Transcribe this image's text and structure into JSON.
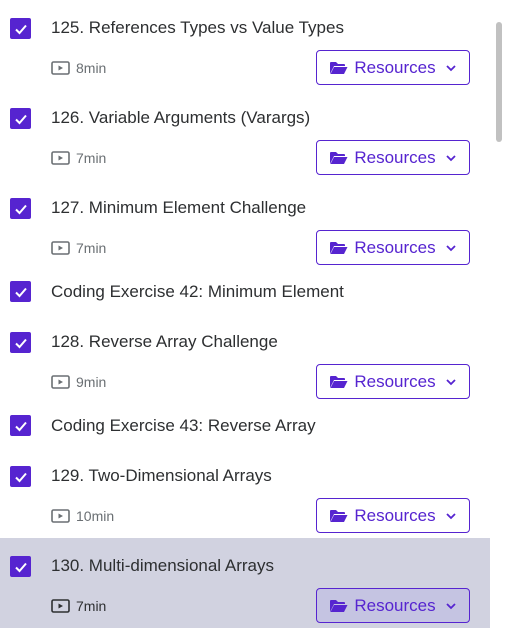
{
  "colors": {
    "accent": "#5624d0",
    "active_bg": "#d1d2e0",
    "text": "#2d2f31",
    "muted": "#6a6f73"
  },
  "resources_label": "Resources",
  "items": [
    {
      "kind": "lecture",
      "title": "125. References Types vs Value Types",
      "duration": "8min",
      "icon": "video-icon",
      "active": false
    },
    {
      "kind": "lecture",
      "title": "126. Variable Arguments (Varargs)",
      "duration": "7min",
      "icon": "video-icon",
      "active": false
    },
    {
      "kind": "lecture",
      "title": "127. Minimum Element Challenge",
      "duration": "7min",
      "icon": "video-icon",
      "active": false
    },
    {
      "kind": "exercise",
      "title": "Coding Exercise 42: Minimum Element",
      "active": false
    },
    {
      "kind": "lecture",
      "title": "128. Reverse Array Challenge",
      "duration": "9min",
      "icon": "video-icon",
      "active": false
    },
    {
      "kind": "exercise",
      "title": "Coding Exercise 43: Reverse Array",
      "active": false
    },
    {
      "kind": "lecture",
      "title": "129. Two-Dimensional Arrays",
      "duration": "10min",
      "icon": "video-icon",
      "active": false
    },
    {
      "kind": "lecture",
      "title": "130. Multi-dimensional Arrays",
      "duration": "7min",
      "icon": "video-icon",
      "active": true
    }
  ]
}
